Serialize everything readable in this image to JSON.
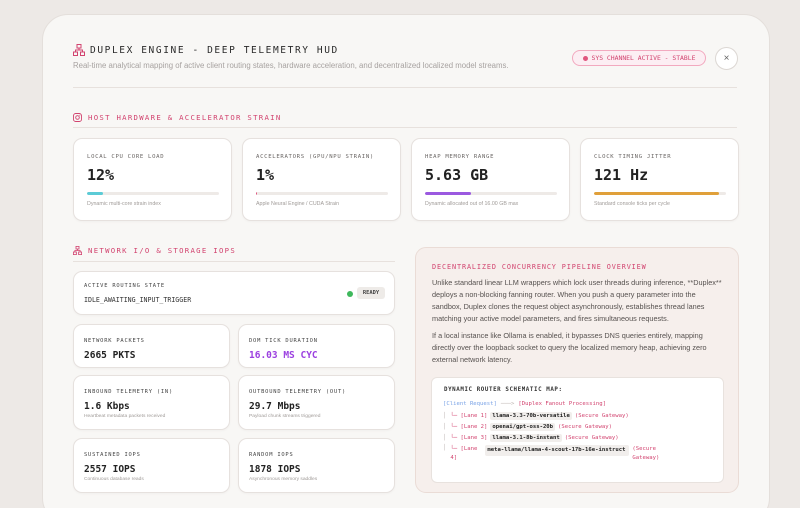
{
  "header": {
    "title": "DUPLEX ENGINE - DEEP TELEMETRY HUD",
    "subtitle": "Real-time analytical mapping of active client routing states, hardware acceleration, and decentralized localized model streams.",
    "status_badge": "SYS CHANNEL ACTIVE - STABLE",
    "close_glyph": "×"
  },
  "hardware": {
    "heading": "HOST HARDWARE & ACCELERATOR STRAIN",
    "metrics": [
      {
        "label": "LOCAL CPU CORE LOAD",
        "value": "12%",
        "sub": "Dynamic multi-core strain index",
        "fill": 0.12,
        "color": "#5ccbd6"
      },
      {
        "label": "ACCELERATORS (GPU/NPU STRAIN)",
        "value": "1%",
        "sub": "Apple Neural Engine / CUDA Strain",
        "fill": 0.01,
        "color": "#e0567f"
      },
      {
        "label": "HEAP MEMORY RANGE",
        "value": "5.63 GB",
        "sub": "Dynamic allocated out of 16.00 GB max",
        "fill": 0.35,
        "color": "#9b59e0"
      },
      {
        "label": "CLOCK TIMING JITTER",
        "value": "121 Hz",
        "sub": "Standard console ticks per cycle",
        "fill": 0.95,
        "color": "#e0a03a"
      }
    ]
  },
  "network": {
    "heading": "NETWORK I/O & STORAGE IOPS",
    "routing": {
      "label": "ACTIVE ROUTING STATE",
      "value": "IDLE_AWAITING_INPUT_TRIGGER",
      "badge": "READY"
    },
    "stats": [
      {
        "label": "NETWORK PACKETS",
        "value": "2665 PKTS",
        "sub": ""
      },
      {
        "label": "DOM TICK DURATION",
        "value": "16.03 MS CYC",
        "sub": ""
      },
      {
        "label": "INBOUND TELEMETRY (IN)",
        "value": "1.6 Kbps",
        "sub": "Heartbeat metadata packets received"
      },
      {
        "label": "OUTBOUND TELEMETRY (OUT)",
        "value": "29.7 Mbps",
        "sub": "Payload chunk streams triggered"
      },
      {
        "label": "SUSTAINED IOPS",
        "value": "2557 IOPS",
        "sub": "Continuous database reads"
      },
      {
        "label": "RANDOM IOPS",
        "value": "1878 IOPS",
        "sub": "Asynchronous memory saddles"
      }
    ],
    "accent_value_color": "#9b3fe0"
  },
  "pipeline": {
    "title": "DECENTRALIZED CONCURRENCY PIPELINE OVERVIEW",
    "paragraph1": "Unlike standard linear LLM wrappers which lock user threads during inference, **Duplex** deploys a non-blocking fanning router. When you push a query parameter into the sandbox, Duplex clones the request object asynchronously, establishes thread lanes matching your active model parameters, and fires simultaneous requests.",
    "paragraph2": "If a local instance like Ollama is enabled, it bypasses DNS queries entirely, mapping directly over the loopback socket to query the localized memory heap, achieving zero external network latency.",
    "schematic": {
      "title": "DYNAMIC ROUTER SCHEMATIC MAP:",
      "root_client": "[Client Request]",
      "root_arrow": "───>",
      "root_target": "[Duplex Fanout Processing]",
      "lanes": [
        {
          "branch": "└─ [Lane 1]",
          "model": "llama-3.3-70b-versatile",
          "gateway": "(Secure Gateway)"
        },
        {
          "branch": "└─ [Lane 2]",
          "model": "openai/gpt-oss-20b",
          "gateway": "(Secure Gateway)"
        },
        {
          "branch": "└─ [Lane 3]",
          "model": "llama-3.1-8b-instant",
          "gateway": "(Secure Gateway)"
        },
        {
          "branch": "└─ [Lane 4]",
          "model": "meta-llama/llama-4-scout-17b-16e-instruct",
          "gateway": "(Secure Gateway)"
        }
      ]
    }
  }
}
